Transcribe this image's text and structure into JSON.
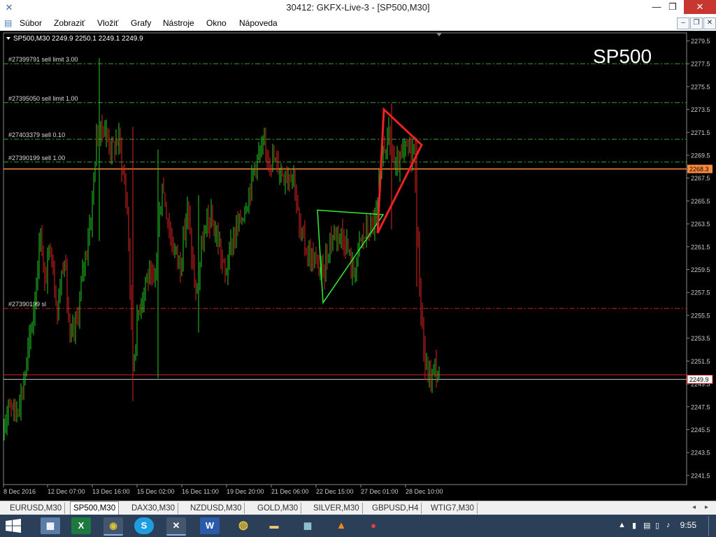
{
  "window": {
    "title": "30412: GKFX-Live-3 - [SP500,M30]",
    "minimize": "—",
    "restore": "❐",
    "close": "✕"
  },
  "menu": {
    "items": [
      "Súbor",
      "Zobraziť",
      "Vložiť",
      "Grafy",
      "Nástroje",
      "Okno",
      "Nápoveda"
    ],
    "mdi_minimize": "–",
    "mdi_restore": "❐",
    "mdi_close": "✕"
  },
  "chart": {
    "header": "SP500,M30  2249.9 2250.1 2249.1 2249.9",
    "symbol_watermark": "SP500",
    "price_labels": [
      "2279.5",
      "2277.5",
      "2275.5",
      "2273.5",
      "2271.5",
      "2269.5",
      "2267.5",
      "2265.5",
      "2263.5",
      "2261.5",
      "2259.5",
      "2257.5",
      "2255.5",
      "2253.5",
      "2251.5",
      "2249.5",
      "2247.5",
      "2245.5",
      "2243.5",
      "2241.5"
    ],
    "current_price_tag": "2249.9",
    "orange_price_tag": "2268.3",
    "date_labels": [
      "8 Dec 2016",
      "12 Dec 07:00",
      "13 Dec 16:00",
      "15 Dec 02:00",
      "16 Dec 11:00",
      "19 Dec 20:00",
      "21 Dec 06:00",
      "22 Dec 15:00",
      "27 Dec 01:00",
      "28 Dec 10:00"
    ],
    "order_lines": [
      {
        "label": "#27399791 sell limit 3.00",
        "price": 2277.5
      },
      {
        "label": "#27395050 sell limit 1.00",
        "price": 2274.1
      },
      {
        "label": "#27403379 sell 0.10",
        "price": 2270.9
      },
      {
        "label": "#27390199 sell 1.00",
        "price": 2268.9
      },
      {
        "label": "#27390199 sl",
        "price": 2256.1
      }
    ],
    "orange_line_price": 2268.3,
    "red_line_price": 2250.3,
    "current_price": 2249.9,
    "colors": {
      "bull": "#22cc22",
      "bear": "#dd2222",
      "orange": "#ff8c3a",
      "order_line": "#2ea62e",
      "sl_line": "#cc2222"
    }
  },
  "chart_data": {
    "type": "candlestick",
    "ylim": [
      2240.7,
      2280.2
    ]
  },
  "tabs": {
    "items": [
      "EURUSD,M30",
      "SP500,M30",
      "DAX30,M30",
      "NZDUSD,M30",
      "GOLD,M30",
      "SILVER,M30",
      "GBPUSD,H4",
      "WTIG7,M30"
    ],
    "active": "SP500,M30"
  },
  "taskbar": {
    "clock": "9:55",
    "apps": [
      "explorer-files",
      "excel",
      "fx-app",
      "skype",
      "metatrader",
      "word",
      "chrome",
      "file-explorer",
      "tiles",
      "vlc",
      "chat"
    ]
  }
}
